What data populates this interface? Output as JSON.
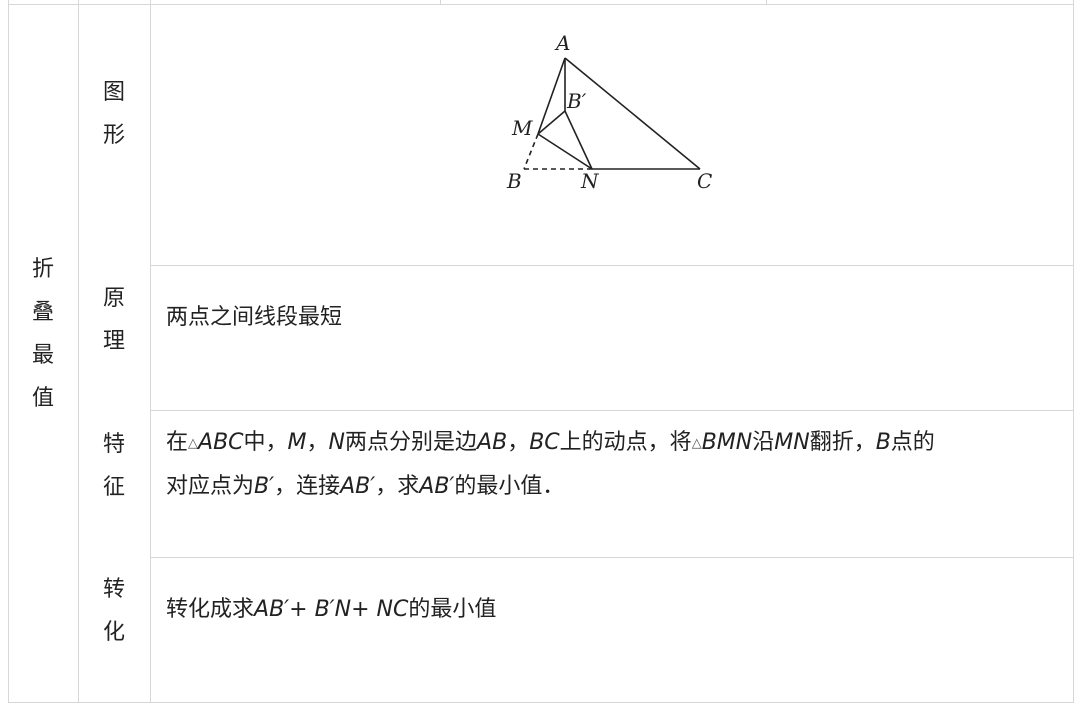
{
  "section_label": [
    "折",
    "叠",
    "最",
    "值"
  ],
  "rows": {
    "figure": {
      "label": [
        "图",
        "形"
      ]
    },
    "principle": {
      "label": [
        "原",
        "理"
      ],
      "text": "两点之间线段最短"
    },
    "feature": {
      "label": [
        "特",
        "征"
      ],
      "line1": {
        "p1": "在",
        "tri1": "△",
        "abc": "ABC",
        "p2": "中，",
        "m": "M",
        "p3": "，",
        "n": "N",
        "p4": "两点分别是边",
        "ab": "AB",
        "p5": "，",
        "bc": "BC",
        "p6": "上的动点，将",
        "tri2": "△",
        "bmn": "BMN",
        "p7": "沿",
        "mn": "MN",
        "p8": "翻折，",
        "b": "B",
        "p9": "点的"
      },
      "line2": {
        "p1": "对应点为",
        "bp": "B′",
        "p2": "，连接",
        "abp": "AB′",
        "p3": "，求",
        "abp2": "AB′",
        "p4": "的最小值．"
      }
    },
    "transform": {
      "label": [
        "转",
        "化"
      ],
      "line": {
        "p1": "转化成求",
        "expr": "AB′+ B′N+ NC",
        "p2": "的最小值"
      }
    }
  },
  "figure_labels": {
    "A": "A",
    "Bp": "B′",
    "M": "M",
    "B": "B",
    "N": "N",
    "C": "C"
  }
}
